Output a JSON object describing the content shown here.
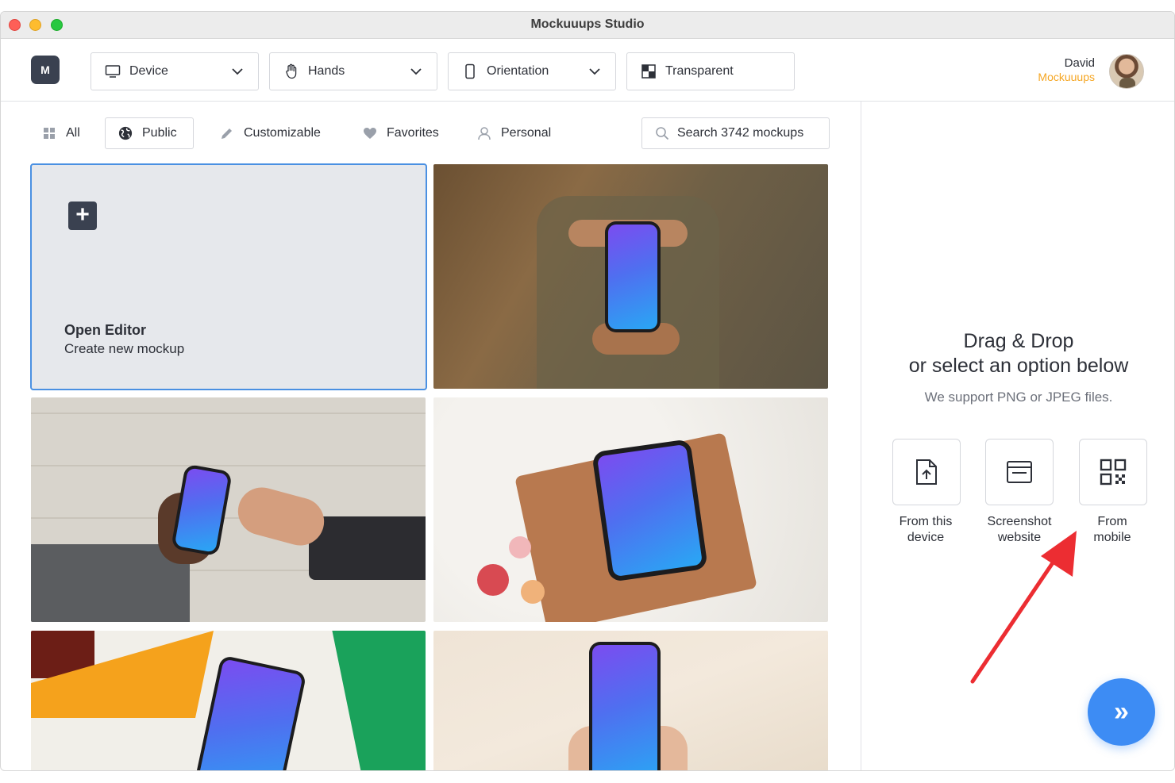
{
  "window": {
    "title": "Mockuuups Studio"
  },
  "toolbar": {
    "logo": "M",
    "dropdowns": [
      {
        "label": "Device",
        "icon": "monitor-icon"
      },
      {
        "label": "Hands",
        "icon": "hand-icon"
      },
      {
        "label": "Orientation",
        "icon": "phone-portrait-icon"
      }
    ],
    "transparent_label": "Transparent",
    "user": {
      "name": "David",
      "org": "Mockuuups"
    }
  },
  "filters": {
    "tabs": [
      {
        "label": "All",
        "icon": "grid-icon"
      },
      {
        "label": "Public",
        "icon": "globe-icon",
        "active": true
      },
      {
        "label": "Customizable",
        "icon": "pencil-icon"
      },
      {
        "label": "Favorites",
        "icon": "heart-icon"
      },
      {
        "label": "Personal",
        "icon": "user-icon"
      }
    ],
    "search_placeholder": "Search 3742 mockups"
  },
  "grid": {
    "editor": {
      "title": "Open Editor",
      "subtitle": "Create new mockup"
    },
    "mockups": [
      {
        "scene": "man in olive shirt holding phone between hands"
      },
      {
        "scene": "hand passing phone against brick wall"
      },
      {
        "scene": "tablet on leather notebook with flowers"
      },
      {
        "scene": "phone on colorful paper background"
      },
      {
        "scene": "hands holding phone on beige background"
      }
    ]
  },
  "dropzone": {
    "title_line1": "Drag & Drop",
    "title_line2": "or select an option below",
    "support": "We support PNG or JPEG files.",
    "options": [
      {
        "label_line1": "From this",
        "label_line2": "device",
        "icon": "upload-file-icon"
      },
      {
        "label_line1": "Screenshot",
        "label_line2": "website",
        "icon": "browser-window-icon"
      },
      {
        "label_line1": "From",
        "label_line2": "mobile",
        "icon": "qr-code-icon"
      }
    ],
    "next_label": "»"
  },
  "colors": {
    "accent_blue": "#3d8cf4",
    "brand_orange": "#f5a623",
    "annotation_red": "#ec2d32"
  }
}
